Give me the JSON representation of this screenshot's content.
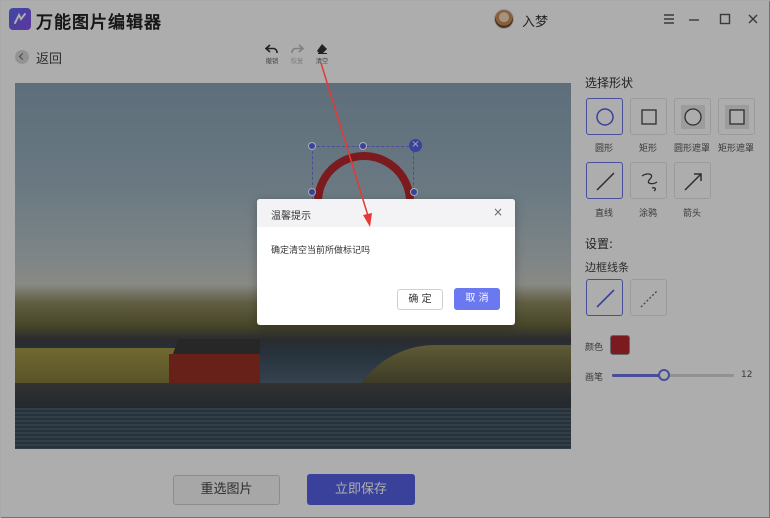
{
  "app": {
    "title": "万能图片编辑器",
    "username": "入梦"
  },
  "toolbar": {
    "back_label": "返回",
    "undo_label": "撤销",
    "redo_label": "恢复",
    "clear_label": "清空"
  },
  "panel": {
    "select_shape_title": "选择形状",
    "shapes": [
      {
        "label": "圆形",
        "icon": "circle-icon",
        "active": true
      },
      {
        "label": "矩形",
        "icon": "square-icon",
        "active": false
      },
      {
        "label": "圆形遮罩",
        "icon": "circle-mask-icon",
        "active": false
      },
      {
        "label": "矩形遮罩",
        "icon": "rect-mask-icon",
        "active": false
      },
      {
        "label": "直线",
        "icon": "line-icon",
        "active": true
      },
      {
        "label": "涂鸦",
        "icon": "scribble-icon",
        "active": false
      },
      {
        "label": "箭头",
        "icon": "arrow-icon",
        "active": false
      }
    ],
    "settings_title": "设置:",
    "border_title": "边框线条",
    "line_styles": [
      {
        "icon": "solid-line-icon",
        "active": true
      },
      {
        "icon": "dashed-line-icon",
        "active": false
      }
    ],
    "color_label": "颜色",
    "color_value": "#b7282e",
    "brush_label": "画笔",
    "brush_value": "12",
    "brush_fraction": 0.42
  },
  "bottom": {
    "reselect_label": "重选图片",
    "save_label": "立即保存"
  },
  "dialog": {
    "title": "温馨提示",
    "message": "确定清空当前所做标记吗",
    "ok_label": "确 定",
    "cancel_label": "取 消",
    "close_symbol": "×"
  },
  "colors": {
    "accent": "#5561e4",
    "annotation_arrow": "#e53935"
  }
}
